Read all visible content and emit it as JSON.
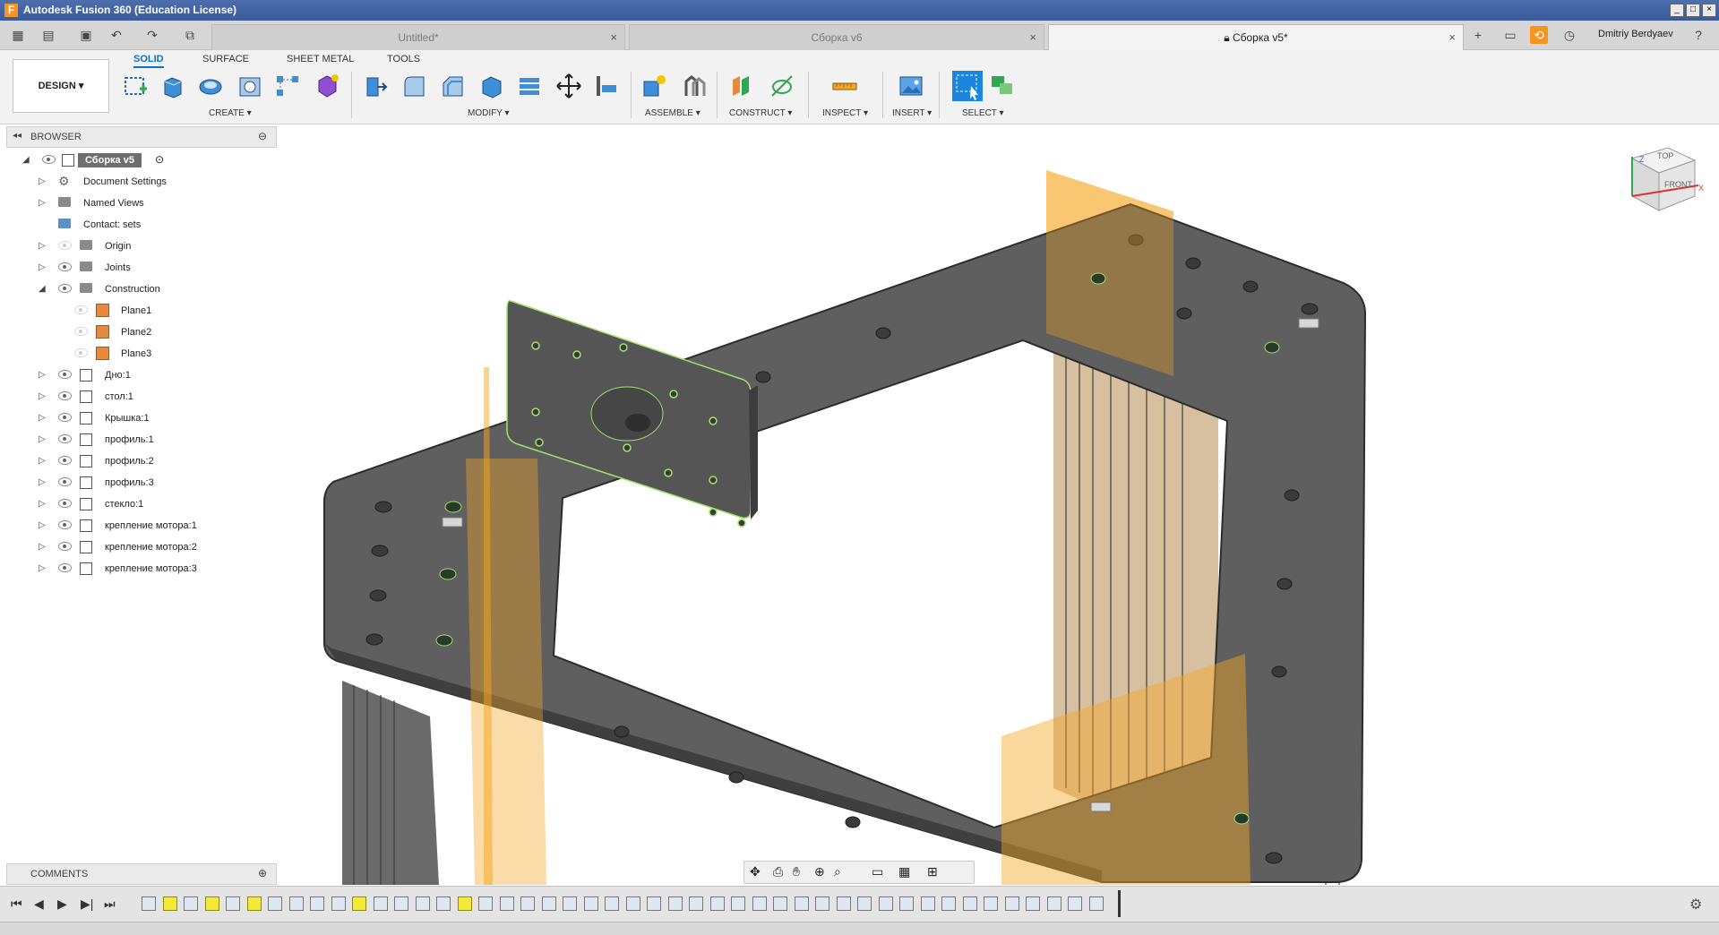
{
  "window": {
    "title": "Autodesk Fusion 360 (Education License)",
    "logo_letter": "F"
  },
  "tabs": [
    {
      "label": "Untitled*",
      "active": false
    },
    {
      "label": "Сборка v6",
      "active": false
    },
    {
      "label": "Сборка v5*",
      "active": true
    }
  ],
  "user": {
    "name": "Dmitriy Berdyaev"
  },
  "toolbar": {
    "design_label": "DESIGN",
    "workspace_tabs": [
      "SOLID",
      "SURFACE",
      "SHEET METAL",
      "TOOLS"
    ],
    "groups": [
      "CREATE",
      "MODIFY",
      "ASSEMBLE",
      "CONSTRUCT",
      "INSPECT",
      "INSERT",
      "SELECT"
    ]
  },
  "browser": {
    "title": "BROWSER",
    "root": "Сборка v5",
    "items": [
      {
        "label": "Document Settings",
        "icon": "gear-icon",
        "level": 1,
        "expanded": false
      },
      {
        "label": "Named Views",
        "icon": "folder-icon",
        "level": 1,
        "expanded": false
      },
      {
        "label": "Contact: sets",
        "icon": "contact-sets-icon",
        "level": 1,
        "expanded": null
      },
      {
        "label": "Origin",
        "icon": "folder-icon",
        "level": 1,
        "expanded": false,
        "hidden": true
      },
      {
        "label": "Joints",
        "icon": "folder-icon",
        "level": 1,
        "expanded": false
      },
      {
        "label": "Construction",
        "icon": "folder-icon",
        "level": 1,
        "expanded": true
      },
      {
        "label": "Plane1",
        "icon": "plane-icon",
        "level": 2,
        "hidden": true
      },
      {
        "label": "Plane2",
        "icon": "plane-icon",
        "level": 2,
        "hidden": true
      },
      {
        "label": "Plane3",
        "icon": "plane-icon",
        "level": 2,
        "hidden": true
      },
      {
        "label": "Дно:1",
        "icon": "component-icon",
        "level": 1,
        "expanded": false
      },
      {
        "label": "стол:1",
        "icon": "component-icon",
        "level": 1,
        "expanded": false
      },
      {
        "label": "Крышка:1",
        "icon": "component-icon",
        "level": 1,
        "expanded": false
      },
      {
        "label": "профиль:1",
        "icon": "component-icon",
        "level": 1,
        "expanded": false
      },
      {
        "label": "профиль:2",
        "icon": "component-icon",
        "level": 1,
        "expanded": false
      },
      {
        "label": "профиль:3",
        "icon": "component-icon",
        "level": 1,
        "expanded": false
      },
      {
        "label": "стекло:1",
        "icon": "component-icon",
        "level": 1,
        "expanded": false
      },
      {
        "label": "крепление мотора:1",
        "icon": "component-icon",
        "level": 1,
        "expanded": false
      },
      {
        "label": "крепление мотора:2",
        "icon": "component-icon",
        "level": 1,
        "expanded": false
      },
      {
        "label": "крепление мотора:3",
        "icon": "component-icon",
        "level": 1,
        "expanded": false
      }
    ]
  },
  "comments": {
    "title": "COMMENTS"
  },
  "viewcube": {
    "top": "TOP",
    "front": "FRONT",
    "z": "Z",
    "x": "X"
  },
  "colors": {
    "accent": "#0b72c6",
    "titlebar": "#3a5a9a",
    "plane": "#f5a623",
    "part": "#5f5f5f"
  }
}
